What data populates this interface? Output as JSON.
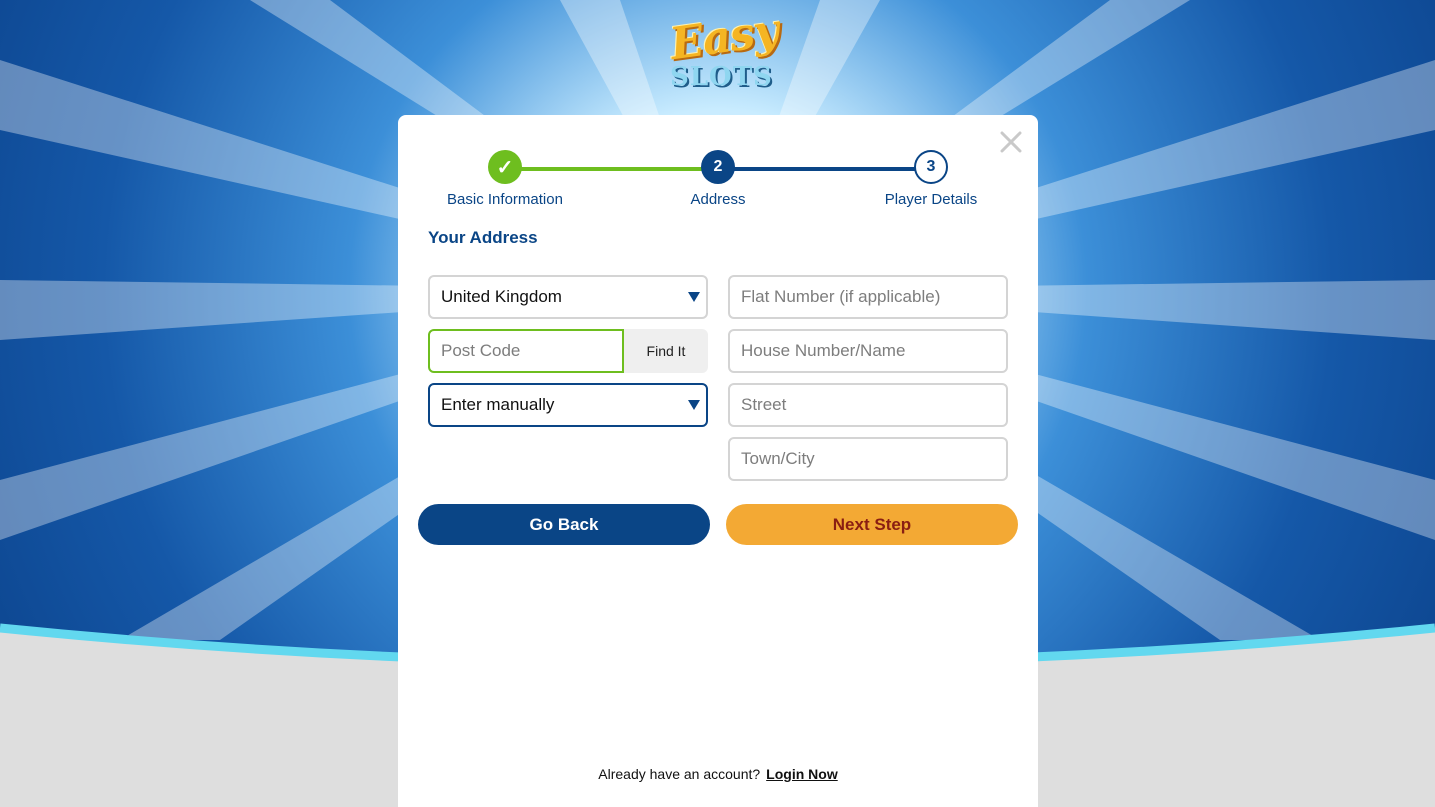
{
  "brand": {
    "logo_top": "Easy",
    "logo_bottom": "SLOTS"
  },
  "colors": {
    "primary_navy": "#0a4586",
    "success_green": "#6ebe1f",
    "accent_orange": "#f3a934",
    "next_text": "#8a1e12"
  },
  "stepper": {
    "steps": [
      {
        "marker": "✓",
        "label": "Basic Information",
        "state": "completed"
      },
      {
        "marker": "2",
        "label": "Address",
        "state": "current"
      },
      {
        "marker": "3",
        "label": "Player Details",
        "state": "upcoming"
      }
    ]
  },
  "form": {
    "section_title": "Your Address",
    "country_select": {
      "value": "United Kingdom"
    },
    "postcode": {
      "placeholder": "Post Code",
      "find_label": "Find It"
    },
    "address_select": {
      "value": "Enter manually"
    },
    "flat": {
      "placeholder": "Flat Number (if applicable)"
    },
    "house": {
      "placeholder": "House Number/Name"
    },
    "street": {
      "placeholder": "Street"
    },
    "town": {
      "placeholder": "Town/City"
    }
  },
  "actions": {
    "back_label": "Go Back",
    "next_label": "Next Step"
  },
  "footer": {
    "prompt": "Already have an account?",
    "login_label": "Login Now"
  }
}
